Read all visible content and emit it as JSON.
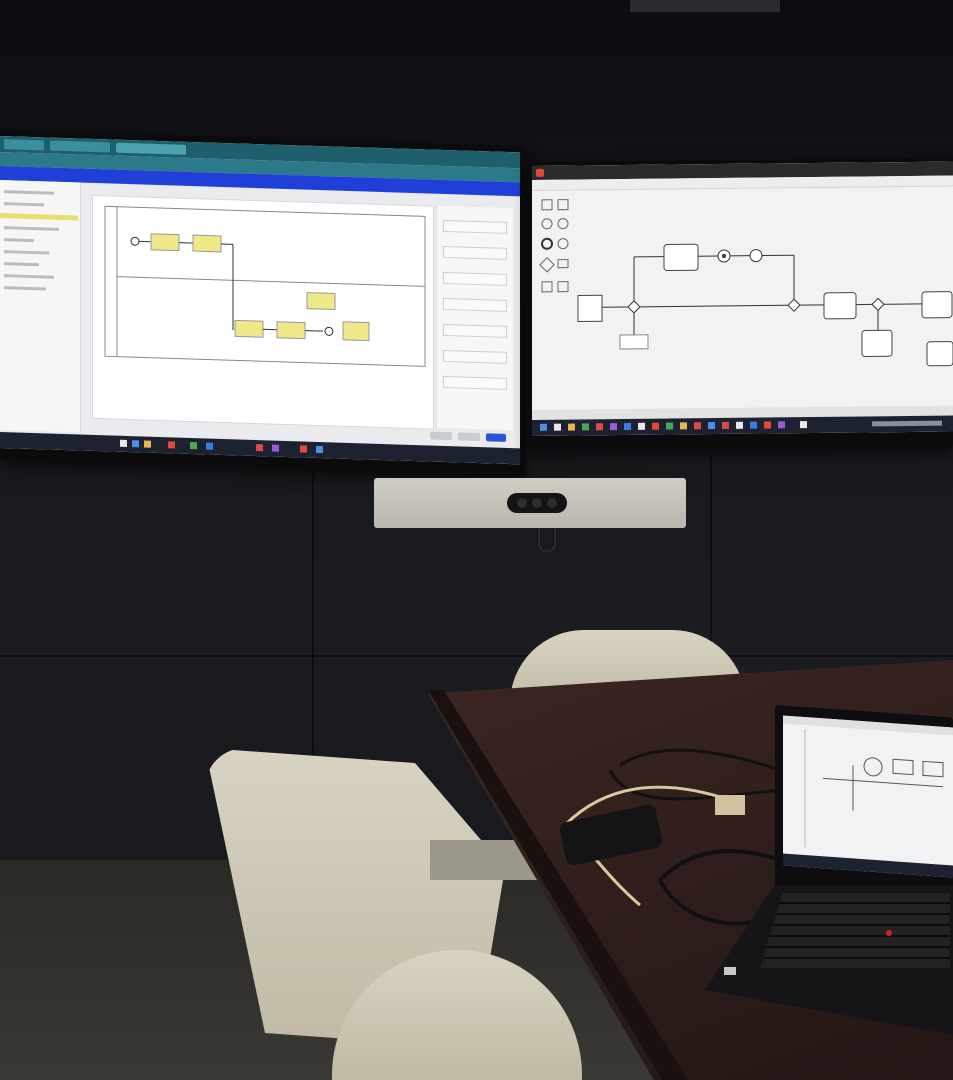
{
  "scene": {
    "description_tags": [
      "conference-room",
      "wall-monitors",
      "laptop",
      "chairs",
      "video-bar"
    ]
  },
  "left_monitor": {
    "app_header_color": "#1f3fd8",
    "browser_color": "#1f5f6d",
    "accent_task_color": "#efe889"
  },
  "right_monitor": {
    "taskbar_color": "#1c2230"
  },
  "laptop": {
    "trackpoint_color": "#d61f1f"
  }
}
